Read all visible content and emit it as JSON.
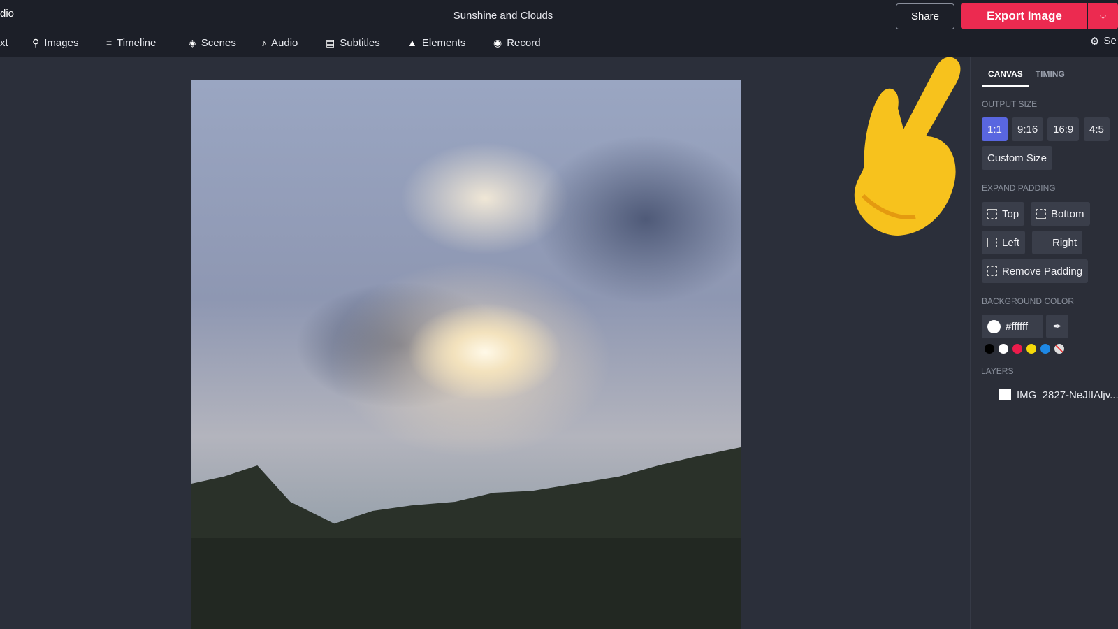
{
  "app": {
    "name_fragment": "dio",
    "title": "Sunshine and Clouds",
    "share": "Share",
    "export": "Export Image",
    "settings": "Se"
  },
  "nav": [
    {
      "label": "xt",
      "icon": "text-icon"
    },
    {
      "label": "Images",
      "icon": "search-icon"
    },
    {
      "label": "Timeline",
      "icon": "timeline-icon"
    },
    {
      "label": "Scenes",
      "icon": "layers-icon"
    },
    {
      "label": "Audio",
      "icon": "music-note-icon"
    },
    {
      "label": "Subtitles",
      "icon": "subtitles-icon"
    },
    {
      "label": "Elements",
      "icon": "shapes-icon"
    },
    {
      "label": "Record",
      "icon": "record-icon"
    }
  ],
  "panel": {
    "tabs": [
      "CANVAS",
      "TIMING"
    ],
    "output_size": {
      "label": "OUTPUT SIZE",
      "options": [
        "1:1",
        "9:16",
        "16:9",
        "4:5"
      ],
      "selected": "1:1",
      "custom": "Custom Size"
    },
    "padding": {
      "label": "EXPAND PADDING",
      "top": "Top",
      "bottom": "Bottom",
      "left": "Left",
      "right": "Right",
      "remove": "Remove Padding"
    },
    "background": {
      "label": "BACKGROUND COLOR",
      "value": "#ffffff",
      "swatches": [
        "#000000",
        "#ffffff",
        "#ec1c4b",
        "#f5d90a",
        "#1e88e5",
        "none"
      ]
    },
    "layers": {
      "label": "LAYERS",
      "items": [
        "IMG_2827-NeJIIAljv..."
      ]
    }
  },
  "colors": {
    "accent": "#ec2a50",
    "selected": "#5966e0"
  }
}
